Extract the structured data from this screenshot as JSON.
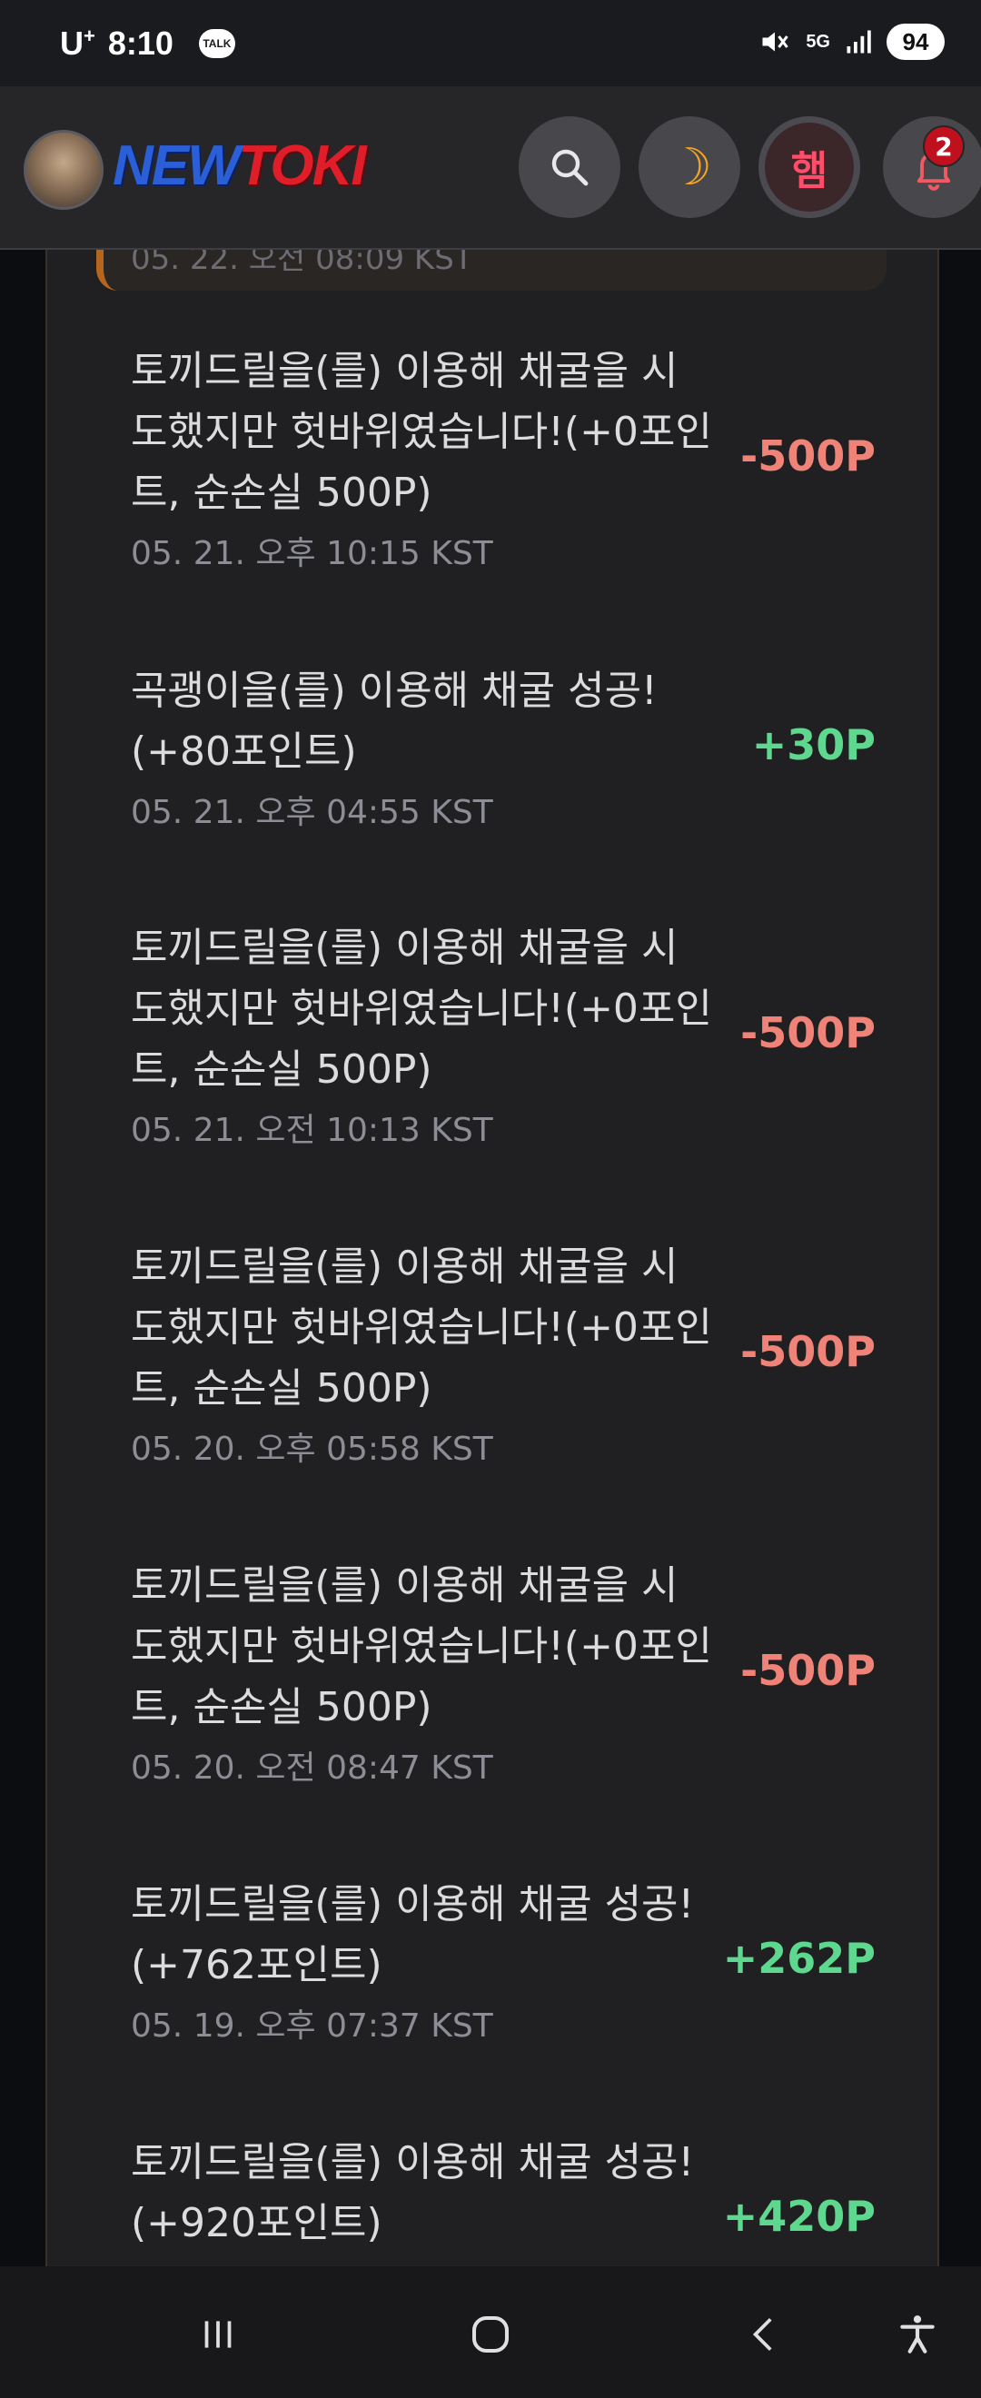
{
  "status_bar": {
    "carrier": "U",
    "carrier_sup": "+",
    "time": "8:10",
    "talk_label": "TALK",
    "network": "5G",
    "battery": "94"
  },
  "header": {
    "logo_new": "NEW",
    "logo_toki": "TOKI",
    "ham_label": "햄",
    "notification_count": "2",
    "accent_blue": "#2a5fd8",
    "accent_red": "#e01e2a"
  },
  "top_partial_time": "05. 22. 오전 08:09 KST",
  "entries": [
    {
      "desc": "토끼드릴을(를) 이용해 채굴을 시도했지만 헛바위였습니다!(+0포인트, 순손실 500P)",
      "time": "05. 21. 오후 10:15 KST",
      "amount": "-500P",
      "kind": "neg"
    },
    {
      "desc": "곡괭이을(를) 이용해 채굴 성공!(+80포인트)",
      "time": "05. 21. 오후 04:55 KST",
      "amount": "+30P",
      "kind": "pos"
    },
    {
      "desc": "토끼드릴을(를) 이용해 채굴을 시도했지만 헛바위였습니다!(+0포인트, 순손실 500P)",
      "time": "05. 21. 오전 10:13 KST",
      "amount": "-500P",
      "kind": "neg"
    },
    {
      "desc": "토끼드릴을(를) 이용해 채굴을 시도했지만 헛바위였습니다!(+0포인트, 순손실 500P)",
      "time": "05. 20. 오후 05:58 KST",
      "amount": "-500P",
      "kind": "neg"
    },
    {
      "desc": "토끼드릴을(를) 이용해 채굴을 시도했지만 헛바위였습니다!(+0포인트, 순손실 500P)",
      "time": "05. 20. 오전 08:47 KST",
      "amount": "-500P",
      "kind": "neg"
    },
    {
      "desc": "토끼드릴을(를) 이용해 채굴 성공!(+762포인트)",
      "time": "05. 19. 오후 07:37 KST",
      "amount": "+262P",
      "kind": "pos"
    },
    {
      "desc": "토끼드릴을(를) 이용해 채굴 성공!(+920포인트)",
      "time": "",
      "amount": "+420P",
      "kind": "pos"
    }
  ],
  "colors": {
    "negative": "#f08378",
    "positive": "#5ed88e"
  }
}
